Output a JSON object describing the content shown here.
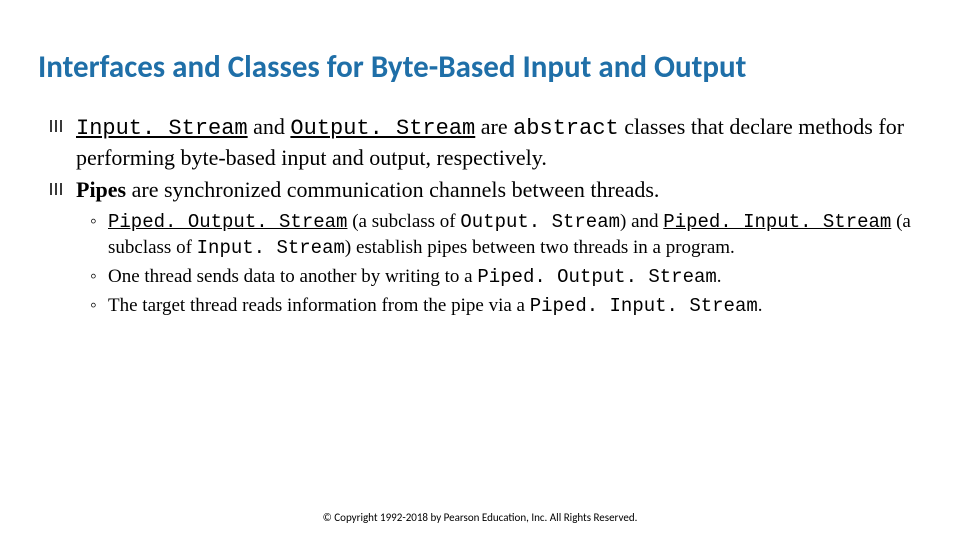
{
  "title": "Interfaces and Classes for Byte-Based Input and Output",
  "bullets": {
    "b1": {
      "code1": "Input. Stream",
      "t1": " and ",
      "code2": "Output. Stream",
      "t2": " are ",
      "code3": "abstract",
      "t3": " classes that declare methods for performing byte-based input and output, respectively."
    },
    "b2": {
      "t1": "Pipes",
      "t2": " are synchronized communication channels between threads."
    }
  },
  "subs": {
    "s1": {
      "code1": "Piped. Output. Stream",
      "t1": " (a subclass of ",
      "code2": "Output. Stream",
      "t2": ") and ",
      "code3": "Piped. Input. Stream",
      "t3": " (a subclass of ",
      "code4": "Input. Stream",
      "t4": ") establish pipes between two threads in a program."
    },
    "s2": {
      "t1": "One thread sends data to another by writing to a ",
      "code1": "Piped. Output. Stream",
      "t2": "."
    },
    "s3": {
      "t1": "The target thread reads information from the pipe via a ",
      "code1": "Piped. Input. Stream",
      "t2": "."
    }
  },
  "footer": "© Copyright 1992-2018 by Pearson Education, Inc. All Rights Reserved."
}
